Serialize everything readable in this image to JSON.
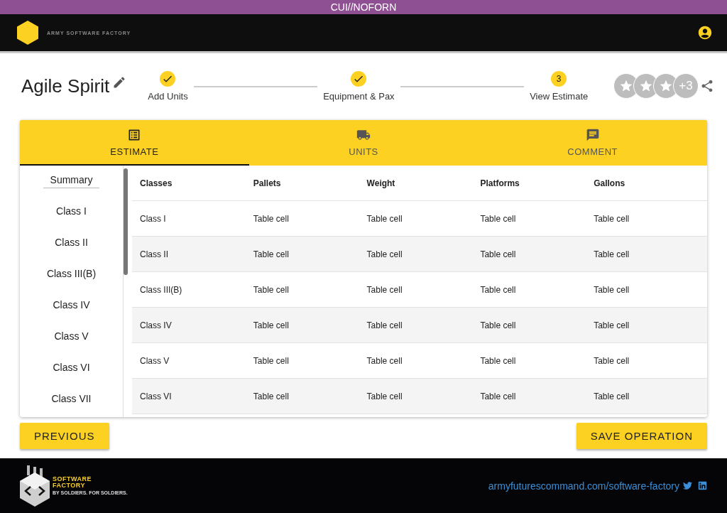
{
  "classification": "CUI//NOFORN",
  "header": {
    "brand": "ARMY SOFTWARE FACTORY"
  },
  "operation": {
    "title": "Agile Spirit"
  },
  "steps": [
    {
      "label": "Add Units",
      "done": true
    },
    {
      "label": "Equipment & Pax",
      "done": true
    },
    {
      "label": "View Estimate",
      "done": false,
      "number": "3"
    }
  ],
  "collaborators": {
    "more": "+3"
  },
  "tabs": [
    {
      "label": "ESTIMATE",
      "selected": true
    },
    {
      "label": "UNITS",
      "selected": false
    },
    {
      "label": "COMMENT",
      "selected": false
    }
  ],
  "sidebar": {
    "items": [
      {
        "label": "Summary",
        "selected": true
      },
      {
        "label": "Class I",
        "selected": false
      },
      {
        "label": "Class II",
        "selected": false
      },
      {
        "label": "Class III(B)",
        "selected": false
      },
      {
        "label": "Class IV",
        "selected": false
      },
      {
        "label": "Class V",
        "selected": false
      },
      {
        "label": "Class VI",
        "selected": false
      },
      {
        "label": "Class VII",
        "selected": false
      }
    ]
  },
  "table": {
    "columns": [
      "Classes",
      "Pallets",
      "Weight",
      "Platforms",
      "Gallons"
    ],
    "rows": [
      [
        "Class I",
        "Table cell",
        "Table cell",
        "Table cell",
        "Table cell"
      ],
      [
        "Class II",
        "Table cell",
        "Table cell",
        "Table cell",
        "Table cell"
      ],
      [
        "Class III(B)",
        "Table cell",
        "Table cell",
        "Table cell",
        "Table cell"
      ],
      [
        "Class IV",
        "Table cell",
        "Table cell",
        "Table cell",
        "Table cell"
      ],
      [
        "Class V",
        "Table cell",
        "Table cell",
        "Table cell",
        "Table cell"
      ],
      [
        "Class VI",
        "Table cell",
        "Table cell",
        "Table cell",
        "Table cell"
      ]
    ]
  },
  "buttons": {
    "previous": "PREVIOUS",
    "save": "SAVE OPERATION"
  },
  "footer": {
    "logo_line1": "SOFTWARE",
    "logo_line2": "FACTORY",
    "logo_tagline": "BY SOLDIERS. FOR SOLDIERS.",
    "link": "armyfuturescommand.com/software-factory"
  }
}
